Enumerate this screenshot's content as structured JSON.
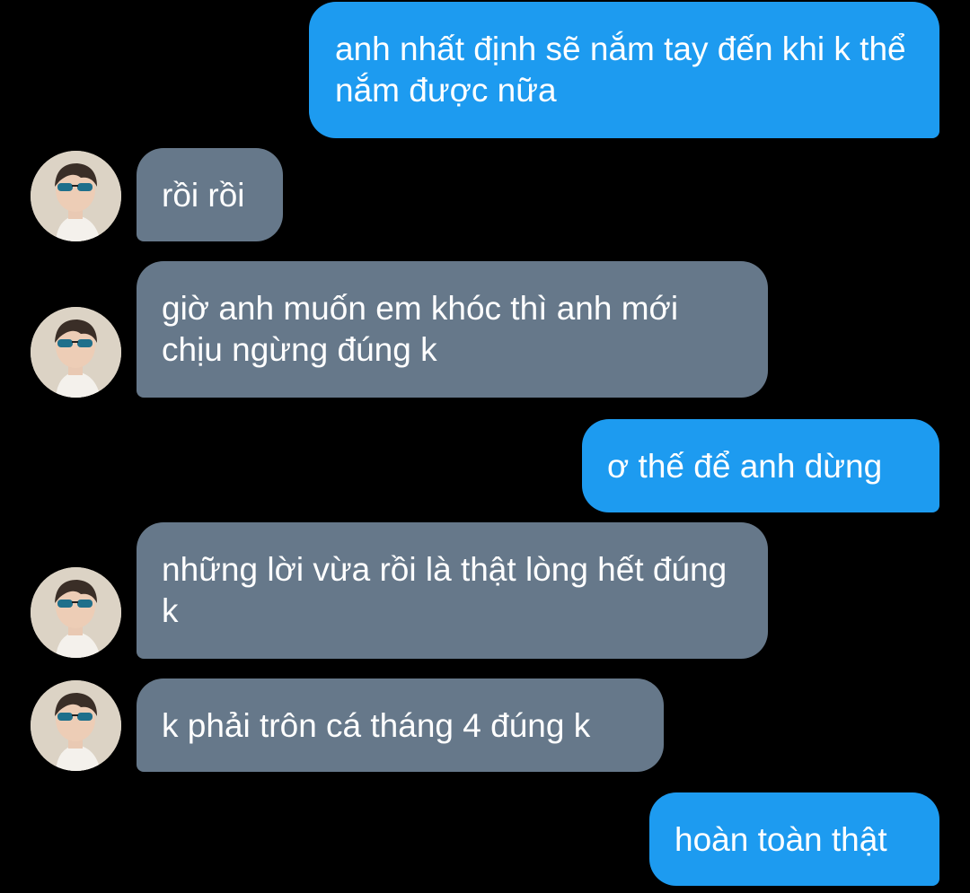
{
  "conversation": {
    "colors": {
      "background": "#000000",
      "sent_bubble": "#1d9bf0",
      "received_bubble": "#66788a",
      "text": "#ffffff"
    },
    "contact_avatar_icon": "person-with-sunglasses-avatar",
    "messages": [
      {
        "direction": "sent",
        "text": "anh nhất định sẽ nắm tay đến khi k thể nắm được nữa"
      },
      {
        "direction": "received",
        "text": "rồi rồi"
      },
      {
        "direction": "received",
        "text": "giờ anh muốn em khóc thì anh mới chịu ngừng đúng k"
      },
      {
        "direction": "sent",
        "text": "ơ thế để anh dừng"
      },
      {
        "direction": "received",
        "text": "những lời vừa rồi là thật lòng hết đúng k"
      },
      {
        "direction": "received",
        "text": "k phải trôn cá tháng 4 đúng k"
      },
      {
        "direction": "sent",
        "text": "hoàn toàn thật"
      }
    ]
  }
}
